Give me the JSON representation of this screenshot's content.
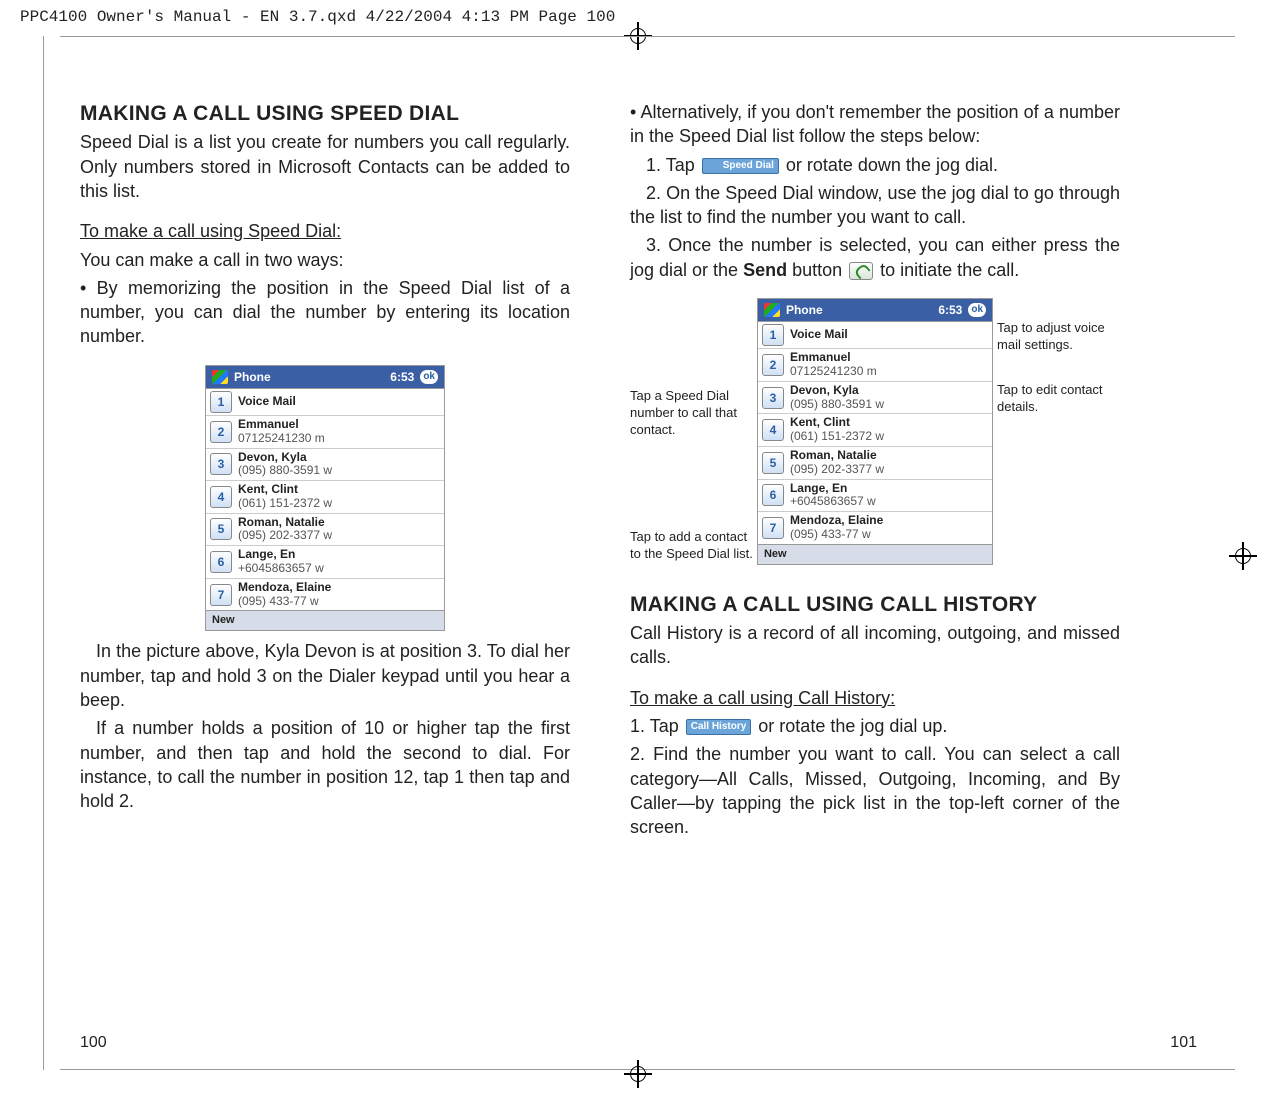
{
  "header_line": "PPC4100 Owner's Manual - EN 3.7.qxd  4/22/2004  4:13 PM  Page 100",
  "page_left_num": "100",
  "page_right_num": "101",
  "left": {
    "h1": "MAKING A CALL USING SPEED DIAL",
    "intro": "Speed Dial is a list you create for numbers you call regularly. Only numbers stored in Microsoft Contacts can be added to this list.",
    "sub1": "To make a call using Speed Dial:",
    "sub1b": "You can make a call in two ways:",
    "bullet1": "•   By memorizing the position in the Speed Dial list of a number, you can dial the number by entering its location number.",
    "after1": "In the picture above, Kyla Devon is at position 3. To dial her number, tap and hold 3 on the Dialer keypad until you hear a beep.",
    "after2": "If a number holds a position of 10 or higher tap the first number, and then tap and hold the second to dial. For instance, to call the number in position 12, tap 1 then tap and hold 2."
  },
  "right": {
    "bullet1a": "•   Alternatively, if you don't remember the position of a number in the Speed Dial list follow the steps below:",
    "step1a": "1.  Tap ",
    "step1b": " or rotate down the jog dial.",
    "step2": "2. On the Speed Dial window, use the jog dial to go through the list to find the number you want to call.",
    "step3a": "3. Once the number is selected, you can either press the jog dial or the ",
    "step3bold": "Send",
    "step3b": " button ",
    "step3c": " to initiate the call.",
    "ann_left_1": "Tap a Speed Dial number to call that contact.",
    "ann_left_2": "Tap to add a contact to the Speed Dial list.",
    "ann_right_1": "Tap to adjust voice mail settings.",
    "ann_right_2": "Tap to edit contact details.",
    "h2": "MAKING A CALL USING CALL HISTORY",
    "h2_intro": "Call History is a record of all incoming, outgoing, and missed calls.",
    "h2_sub": "To make a call using Call History:",
    "h2_s1a": "1. Tap ",
    "h2_s1b": " or rotate the jog dial up.",
    "h2_s2": "2. Find the number you want to call. You can select a call category—All Calls, Missed, Outgoing, Incoming, and By Caller—by tapping the pick list in the top-left corner of the screen."
  },
  "buttons": {
    "speed_dial": "Speed Dial",
    "call_history": "Call History"
  },
  "phone": {
    "title": "Phone",
    "time": "6:53",
    "ok": "ok",
    "new": "New",
    "rows": [
      {
        "n": "1",
        "name": "Voice Mail",
        "sub": ""
      },
      {
        "n": "2",
        "name": "Emmanuel",
        "sub": "07125241230 m"
      },
      {
        "n": "3",
        "name": "Devon, Kyla",
        "sub": "(095) 880-3591 w"
      },
      {
        "n": "4",
        "name": "Kent, Clint",
        "sub": "(061) 151-2372 w"
      },
      {
        "n": "5",
        "name": "Roman, Natalie",
        "sub": "(095) 202-3377 w"
      },
      {
        "n": "6",
        "name": "Lange, En",
        "sub": "+6045863657 w"
      },
      {
        "n": "7",
        "name": "Mendoza, Elaine",
        "sub": "(095) 433-77 w"
      }
    ]
  }
}
